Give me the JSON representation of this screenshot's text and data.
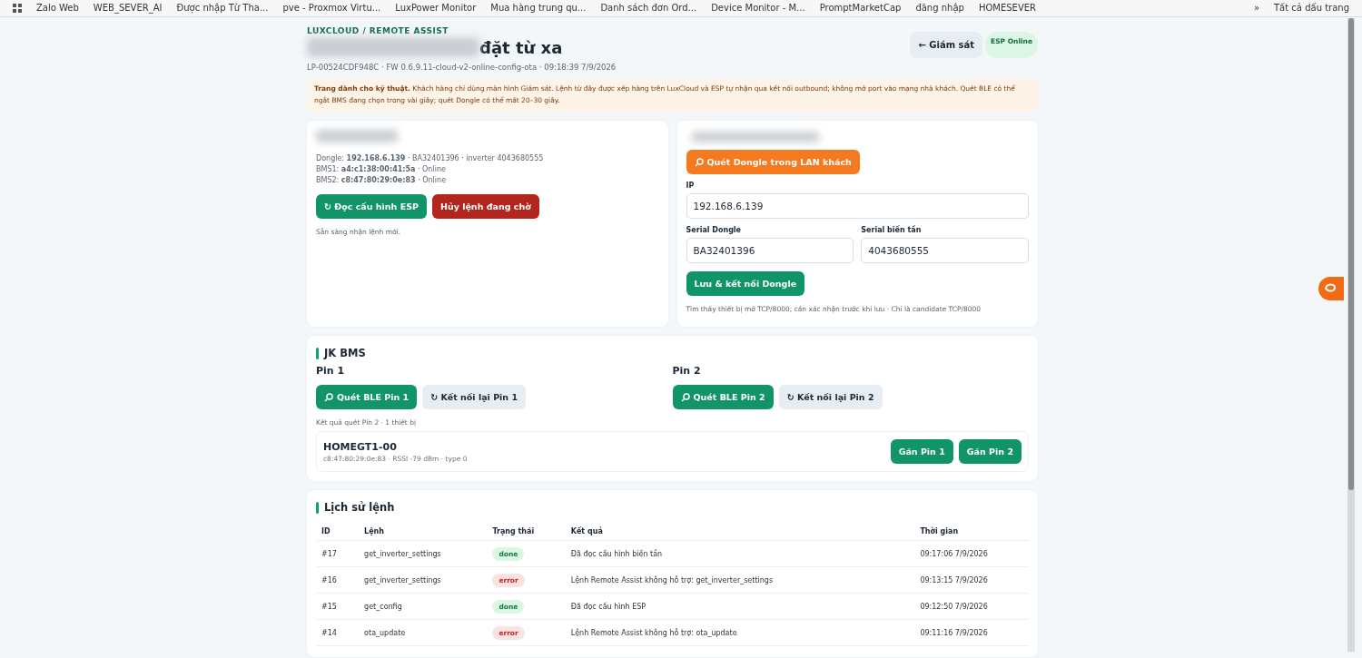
{
  "bookmarks": {
    "items": [
      "Zalo Web",
      "WEB_SEVER_AI",
      "Được nhập Từ Tha...",
      "pve - Proxmox Virtu...",
      "LuxPower Monitor",
      "Mua hàng trung qu...",
      "Danh sách đơn Ord...",
      "Device Monitor - M...",
      "PromptMarketCap",
      "đăng nhập",
      "HOMESEVER"
    ],
    "overflow": "»",
    "all": "Tất cả dấu trang"
  },
  "header": {
    "breadcrumb": "LUXCLOUD / REMOTE ASSIST",
    "title": "đặt từ xa",
    "meta": "LP-00524CDF948C · FW 0.6.9.11-cloud-v2-online-config-ota · 09:18:39 7/9/2026",
    "back_button": "← Giám sát",
    "badge": "ESP Online"
  },
  "notice": "**Trang dành cho kỹ thuật.** Khách hàng chỉ dùng màn hình Giám sát. Lệnh từ đây được xếp hàng trên LuxCloud và ESP tự nhận qua kết nối outbound; không mở port vào mạng nhà khách. Quét BLE có thể ngắt BMS đang chọn trong vài giây; quét Dongle có thể mất 20–30 giây.",
  "status_card": {
    "lines": [
      "Dongle: **192.168.6.139** · BA32401396 · inverter 4043680555",
      "BMS1: **a4:c1:38:00:41:5a** · Online",
      "BMS2: **c8:47:80:29:0e:83** · Online"
    ],
    "buttons": [
      {
        "label": "↻ Đọc cấu hình ESP",
        "kind": "primary"
      },
      {
        "label": "Hủy lệnh đang chờ",
        "kind": "danger"
      }
    ],
    "status": "Sẵn sàng nhận lệnh mới."
  },
  "dongle_card": {
    "scan_button": "Quét Dongle trong LAN khách",
    "ip_label": "IP",
    "ip_value": "192.168.6.139",
    "fields": [
      {
        "label": "Serial Dongle",
        "value": "BA32401396"
      },
      {
        "label": "Serial biến tần",
        "value": "4043680555"
      }
    ],
    "save_button": "Lưu & kết nối Dongle",
    "hint": "Tìm thấy thiết bị mở TCP/8000; cần xác nhận trước khi lưu · Chỉ là candidate TCP/8000"
  },
  "bms_card": {
    "title": "JK BMS",
    "pins": [
      {
        "label": "Pin 1",
        "scan": "Quét BLE Pin 1",
        "reconnect": "↻ Kết nối lại Pin 1"
      },
      {
        "label": "Pin 2",
        "scan": "Quét BLE Pin 2",
        "reconnect": "↻ Kết nối lại Pin 2"
      }
    ],
    "result_label": "Kết quả quét Pin 2 · 1 thiết bị",
    "devices": [
      {
        "name": "HOMEGT1-00",
        "meta": "c8:47:80:29:0e:83 · RSSI -79 dBm · type 0",
        "actions": [
          "Gán Pin 1",
          "Gán Pin 2"
        ]
      }
    ]
  },
  "history": {
    "title": "Lịch sử lệnh",
    "columns": [
      "ID",
      "Lệnh",
      "Trạng thái",
      "Kết quả",
      "Thời gian"
    ],
    "rows": [
      {
        "id": "#17",
        "command": "get_inverter_settings",
        "status": "done",
        "kind": "success",
        "result": "Đã đọc cấu hình biến tần",
        "time": "09:17:06 7/9/2026"
      },
      {
        "id": "#16",
        "command": "get_inverter_settings",
        "status": "error",
        "kind": "danger",
        "result": "Lệnh Remote Assist không hỗ trợ: get_inverter_settings",
        "time": "09:13:15 7/9/2026"
      },
      {
        "id": "#15",
        "command": "get_config",
        "status": "done",
        "kind": "success",
        "result": "Đã đọc cấu hình ESP",
        "time": "09:12:50 7/9/2026"
      },
      {
        "id": "#14",
        "command": "ota_update",
        "status": "error",
        "kind": "danger",
        "result": "Lệnh Remote Assist không hỗ trợ: ota_update",
        "time": "09:11:16 7/9/2026"
      }
    ]
  }
}
